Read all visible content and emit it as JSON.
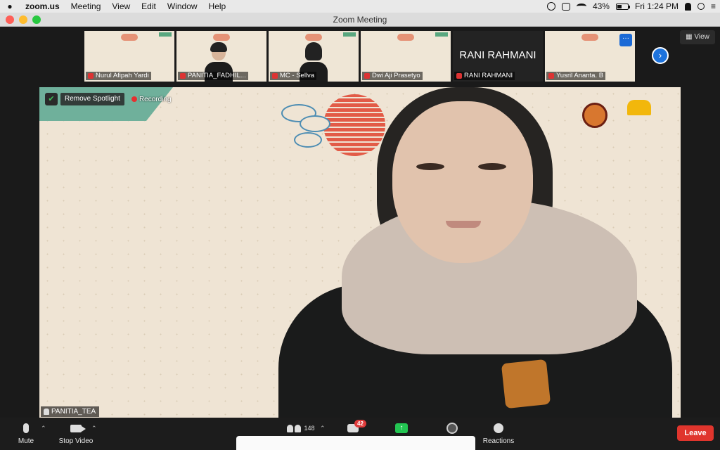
{
  "menubar": {
    "app": "zoom.us",
    "menus": [
      "Meeting",
      "View",
      "Edit",
      "Window",
      "Help"
    ],
    "battery_percent": "43%",
    "battery_level": 0.43,
    "clock": "Fri 1:24 PM"
  },
  "window": {
    "title": "Zoom Meeting"
  },
  "strip": {
    "tiles": [
      {
        "name": "Nurul Afipah Yardi"
      },
      {
        "name": "PANITIA_FADHIL..."
      },
      {
        "name": "MC - Sellva"
      },
      {
        "name": "Dwi Aji Prasetyo"
      },
      {
        "name": "RANI RAHMANI",
        "display_name": "RANI RAHMANI"
      },
      {
        "name": "Yusril Ananta. B",
        "more": "···"
      }
    ],
    "view_label": "View"
  },
  "main": {
    "remove_spotlight": "Remove Spotlight",
    "recording": "Recording",
    "speaker_name": "PANITIA_TEA"
  },
  "toolbar": {
    "mute": "Mute",
    "stop_video": "Stop Video",
    "participants_count": "148",
    "chat_badge": "42",
    "reactions": "Reactions",
    "leave": "Leave"
  },
  "colors": {
    "leave": "#e0352d",
    "share": "#23c552",
    "accent_blue": "#1d73dd",
    "background_cream": "#efe4d4",
    "band_green": "#6fb09b"
  }
}
